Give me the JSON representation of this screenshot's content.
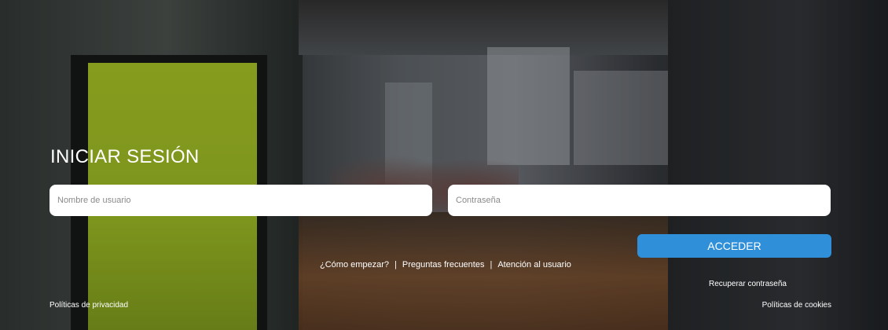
{
  "login": {
    "title": "INICIAR SESIÓN",
    "username_placeholder": "Nombre de usuario",
    "password_placeholder": "Contraseña",
    "submit_label": "ACCEDER",
    "recover_label": "Recuperar contraseña"
  },
  "help_links": {
    "how_to_start": "¿Cómo empezar?",
    "faq": "Preguntas frecuentes",
    "support": "Atención al usuario",
    "separator": "|"
  },
  "footer": {
    "privacy": "Políticas de privacidad",
    "cookies": "Políticas de cookies"
  },
  "colors": {
    "accent": "#2f8fd9"
  }
}
